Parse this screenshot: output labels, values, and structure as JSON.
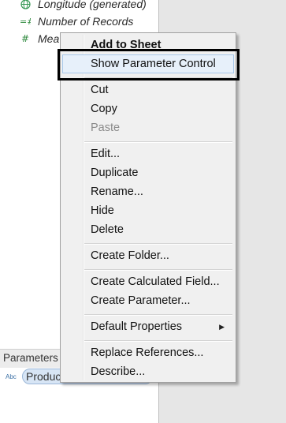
{
  "data_pane": {
    "fields": [
      {
        "label": "Longitude (generated)",
        "icon": "globe-icon"
      },
      {
        "label": "Number of Records",
        "icon": "measure-hash-icon"
      },
      {
        "label": "Mea",
        "icon": "hash-icon"
      }
    ],
    "parameters_header": "Parameters",
    "parameter": {
      "type_badge": "Abc",
      "name": "Produc"
    }
  },
  "context_menu": {
    "header": "Add to Sheet",
    "items": [
      {
        "label": "Show Parameter Control",
        "highlighted": true
      },
      {
        "label": "Cut"
      },
      {
        "label": "Copy"
      },
      {
        "label": "Paste",
        "disabled": true
      },
      {
        "label": "Edit..."
      },
      {
        "label": "Duplicate"
      },
      {
        "label": "Rename..."
      },
      {
        "label": "Hide"
      },
      {
        "label": "Delete"
      },
      {
        "label": "Create Folder..."
      },
      {
        "label": "Create Calculated Field..."
      },
      {
        "label": "Create Parameter..."
      },
      {
        "label": "Default Properties",
        "submenu": true
      },
      {
        "label": "Replace References..."
      },
      {
        "label": "Describe..."
      }
    ]
  },
  "colors": {
    "menu_background": "#f0f0f0",
    "highlight": "#e7f0fa",
    "annotation_box": "#000000",
    "parameter_pill": "#d7e5f5"
  }
}
